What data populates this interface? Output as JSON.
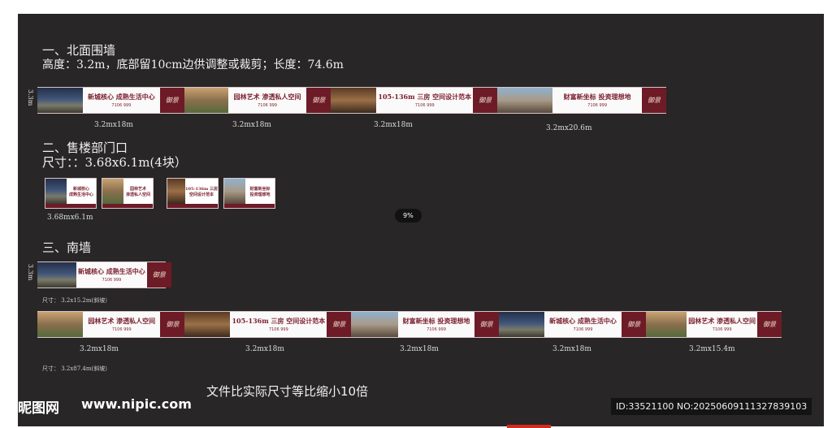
{
  "section1": {
    "title": "一、北面围墙",
    "spec": "高度：3.2m，底部留10cm边供调整或裁剪；长度：74.6m",
    "side_label": "3.3m",
    "panels": [
      {
        "slogan": "新城核心 成熟生活中心",
        "phone": "7106 999",
        "caption": "3.2mx18m"
      },
      {
        "slogan": "园林艺术 渗透私人空间",
        "phone": "7106 999",
        "caption": "3.2mx18m"
      },
      {
        "slogan": "105-136m 三房 空间设计范本",
        "phone": "7106 999",
        "caption": "3.2mx18m"
      },
      {
        "slogan": "财富新坐标 投资理想地",
        "phone": "7106 999",
        "caption": "3.2mx20.6m"
      }
    ]
  },
  "section2": {
    "title": "二、售楼部门口",
    "spec": "尺寸：：3.68x6.1m(4块）",
    "caption": "3.68mx6.1m",
    "doors": [
      {
        "line1": "新城核心",
        "line2": "成熟生活中心"
      },
      {
        "line1": "园林艺术",
        "line2": "渗透私人空间"
      },
      {
        "line1": "105-136m 三房",
        "line2": "空间设计范本"
      },
      {
        "line1": "财富新坐标",
        "line2": "投资理想地"
      }
    ]
  },
  "zoom_badge": "9%",
  "section3": {
    "title": "三、南墙",
    "side_label": "3.3m",
    "single_panel": {
      "slogan": "新城核心 成熟生活中心",
      "phone": "7106 999"
    },
    "single_size": "尺寸： 3.2x15.2m(斜坡）",
    "panels": [
      {
        "slogan": "园林艺术 渗透私人空间",
        "phone": "7106 999",
        "caption": "3.2mx18m"
      },
      {
        "slogan": "105-136m 三房 空间设计范本",
        "phone": "7106 999",
        "caption": "3.2mx18m"
      },
      {
        "slogan": "财富新坐标 投资理想地",
        "phone": "7106 999",
        "caption": "3.2mx18m"
      },
      {
        "slogan": "新城核心 成熟生活中心",
        "phone": "7106 999",
        "caption": "3.2mx18m"
      },
      {
        "slogan": "园林艺术 渗透私人空间",
        "phone": "7106 999",
        "caption": "3.2mx15.4m"
      }
    ],
    "total_size": "尺寸： 3.2x87.4m(斜坡）"
  },
  "scale_note": "文件比实际尺寸等比缩小10倍",
  "watermark": {
    "site_cn": "昵图网",
    "site_url": "www.nipic.com",
    "id_text": "ID:33521100 NO:20250609111327839103"
  },
  "logo_text": "御景"
}
